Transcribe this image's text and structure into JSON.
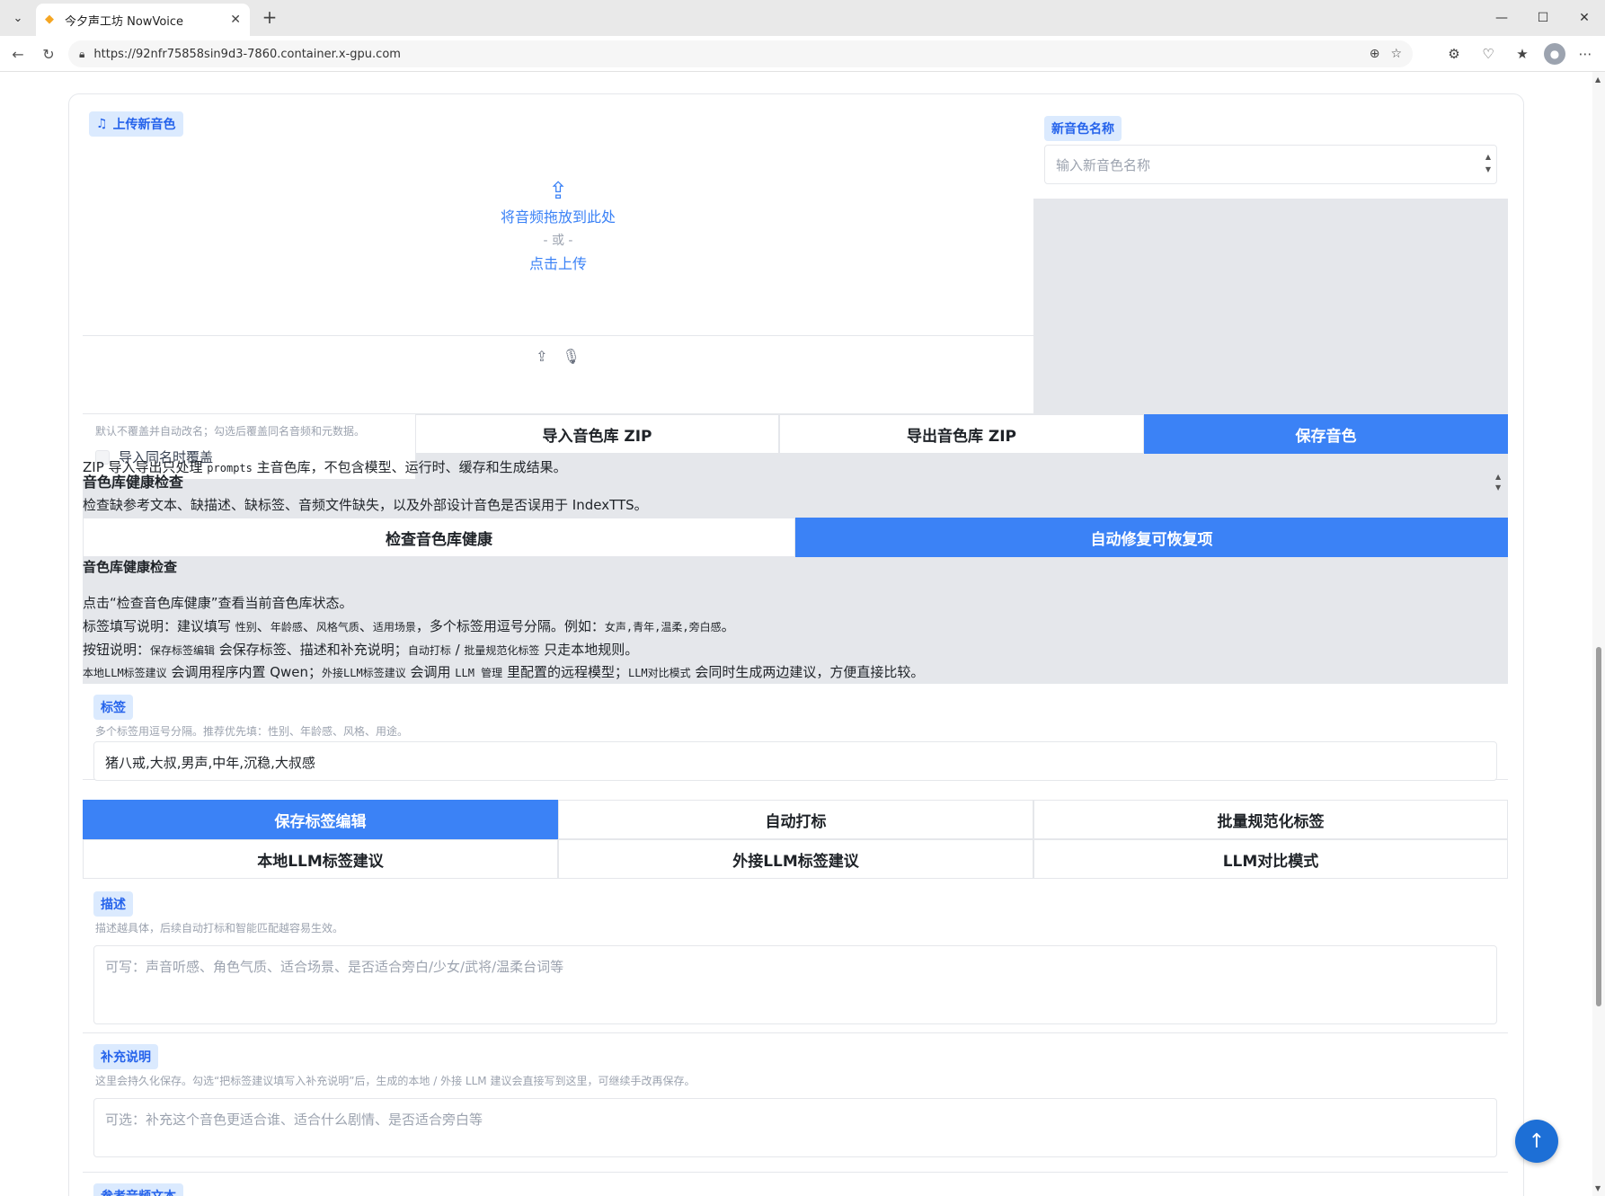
{
  "browser": {
    "tab_title": "今夕声工坊 NowVoice",
    "url": "https://92nfr75858sin9d3-7860.container.x-gpu.com"
  },
  "upload": {
    "label": "上传新音色",
    "drop_text": "将音频拖放到此处",
    "or_text": "- 或 -",
    "click_text": "点击上传"
  },
  "new_name": {
    "label": "新音色名称",
    "placeholder": "输入新音色名称"
  },
  "overwrite": {
    "hint": "默认不覆盖并自动改名；勾选后覆盖同名音频和元数据。",
    "checkbox_label": "导入同名时覆盖"
  },
  "library_buttons": {
    "import_zip": "导入音色库 ZIP",
    "export_zip": "导出音色库 ZIP",
    "save_voice": "保存音色"
  },
  "zip_note": {
    "before": "ZIP 导入导出只处理 ",
    "code": "prompts",
    "after": " 主音色库，不包含模型、运行时、缓存和生成结果。"
  },
  "health": {
    "title": "音色库健康检查",
    "desc": "检查缺参考文本、缺描述、缺标签、音频文件缺失，以及外部设计音色是否误用于 IndexTTS。",
    "check_button": "检查音色库健康",
    "autofix_button": "自动修复可恢复项",
    "result_title": "音色库健康检查",
    "result_hint": "点击“检查音色库健康”查看当前音色库状态。"
  },
  "help": {
    "line1_a": "标签填写说明：建议填写 ",
    "line1_c1": "性别",
    "line1_sep1": "、",
    "line1_c2": "年龄感",
    "line1_sep2": "、",
    "line1_c3": "风格气质",
    "line1_sep3": "、",
    "line1_c4": "适用场景",
    "line1_b": "，多个标签用逗号分隔。例如：",
    "line1_c5": "女声,青年,温柔,旁白感",
    "line1_end": "。",
    "line2_a": "按钮说明：",
    "line2_c1": "保存标签编辑",
    "line2_b": " 会保存标签、描述和补充说明；",
    "line2_c2": "自动打标",
    "line2_sep": " / ",
    "line2_c3": "批量规范化标签",
    "line2_c": " 只走本地规则。",
    "line3_c1": "本地LLM标签建议",
    "line3_a": " 会调用程序内置 Qwen；",
    "line3_c2": "外接LLM标签建议",
    "line3_b": " 会调用 ",
    "line3_c3": "LLM 管理",
    "line3_c": " 里配置的远程模型；",
    "line3_c4": "LLM对比模式",
    "line3_d": " 会同时生成两边建议，方便直接比较。"
  },
  "tags": {
    "label": "标签",
    "hint": "多个标签用逗号分隔。推荐优先填：性别、年龄感、风格、用途。",
    "value": "猪八戒,大叔,男声,中年,沉稳,大叔感"
  },
  "tag_buttons": {
    "save_edit": "保存标签编辑",
    "auto_tag": "自动打标",
    "normalize": "批量规范化标签",
    "local_llm": "本地LLM标签建议",
    "remote_llm": "外接LLM标签建议",
    "compare": "LLM对比模式"
  },
  "description": {
    "label": "描述",
    "hint": "描述越具体，后续自动打标和智能匹配越容易生效。",
    "placeholder": "可写：声音听感、角色气质、适合场景、是否适合旁白/少女/武将/温柔台词等"
  },
  "supplement": {
    "label": "补充说明",
    "hint": "这里会持久化保存。勾选“把标签建议填写入补充说明”后，生成的本地 / 外接 LLM 建议会直接写到这里，可继续手改再保存。",
    "placeholder": "可选：补充这个音色更适合谁、适合什么剧情、是否适合旁白等"
  },
  "reference": {
    "label": "参考音频文本"
  },
  "colors": {
    "accent": "#3b82f6",
    "chip_bg": "#dbeafe",
    "panel_gray": "#e5e7eb"
  }
}
